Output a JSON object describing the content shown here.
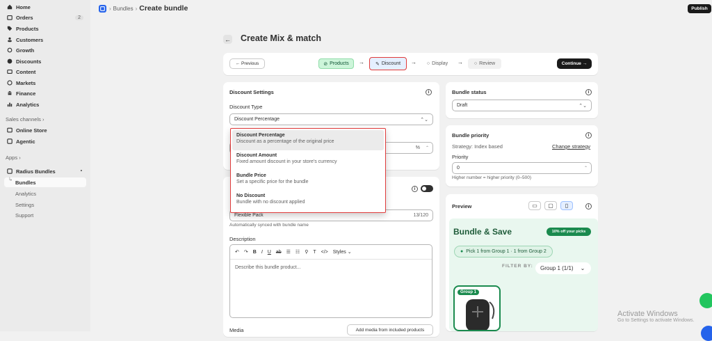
{
  "sidebar": {
    "items": [
      {
        "label": "Home",
        "icon": "home-icon"
      },
      {
        "label": "Orders",
        "icon": "orders-icon",
        "badge": "2"
      },
      {
        "label": "Products",
        "icon": "tag-icon"
      },
      {
        "label": "Customers",
        "icon": "person-icon"
      },
      {
        "label": "Growth",
        "icon": "growth-icon"
      },
      {
        "label": "Discounts",
        "icon": "discount-icon"
      },
      {
        "label": "Content",
        "icon": "content-icon"
      },
      {
        "label": "Markets",
        "icon": "globe-icon"
      },
      {
        "label": "Finance",
        "icon": "bank-icon"
      },
      {
        "label": "Analytics",
        "icon": "chart-icon"
      }
    ],
    "sales_channels_label": "Sales channels",
    "channels": [
      {
        "label": "Online Store",
        "icon": "store-icon"
      },
      {
        "label": "Agentic",
        "icon": "agentic-icon"
      }
    ],
    "apps_label": "Apps",
    "app_name": "Radius Bundles",
    "app_sub": [
      "Bundles",
      "Analytics",
      "Settings",
      "Support"
    ]
  },
  "topbar": {
    "crumb": "Bundles",
    "current": "Create bundle",
    "publish": "Publish"
  },
  "page_title": "Create Mix & match",
  "stepper": {
    "previous": "← Previous",
    "steps": [
      "Products",
      "Discount",
      "Display",
      "Review"
    ],
    "continue": "Continue →"
  },
  "discount": {
    "title": "Discount Settings",
    "type_label": "Discount Type",
    "type_value": "Discount Percentage",
    "percent_suffix": "%",
    "options": [
      {
        "title": "Discount Percentage",
        "desc": "Discount as a percentage of the original price"
      },
      {
        "title": "Discount Amount",
        "desc": "Fixed amount discount in your store's currency"
      },
      {
        "title": "Bundle Price",
        "desc": "Set a specific price for the bundle"
      },
      {
        "title": "No Discount",
        "desc": "Bundle with no discount applied"
      }
    ]
  },
  "details": {
    "name_value": "Flexible Pack",
    "name_count": "13/120",
    "name_help": "Automatically synced with bundle name",
    "desc_label": "Description",
    "toolbar_styles": "Styles",
    "desc_placeholder": "Describe this bundle product...",
    "media_label": "Media",
    "media_button": "Add media from included products"
  },
  "status": {
    "title": "Bundle status",
    "value": "Draft"
  },
  "priority": {
    "title": "Bundle priority",
    "strategy": "Strategy: Index based",
    "change": "Change strategy",
    "label": "Priority",
    "value": "0",
    "help": "Higher number = higher priority (0–500)"
  },
  "preview": {
    "title": "Preview",
    "bundle_title": "Bundle & Save",
    "badge": "10% off your picks",
    "pick": "Pick 1 from Group 1 · 1 from Group 2",
    "filter_by": "FILTER BY:",
    "group": "Group 1 (1/1)",
    "product_tag": "Group 1"
  },
  "watermark": {
    "title": "Activate Windows",
    "sub": "Go to Settings to activate Windows."
  }
}
